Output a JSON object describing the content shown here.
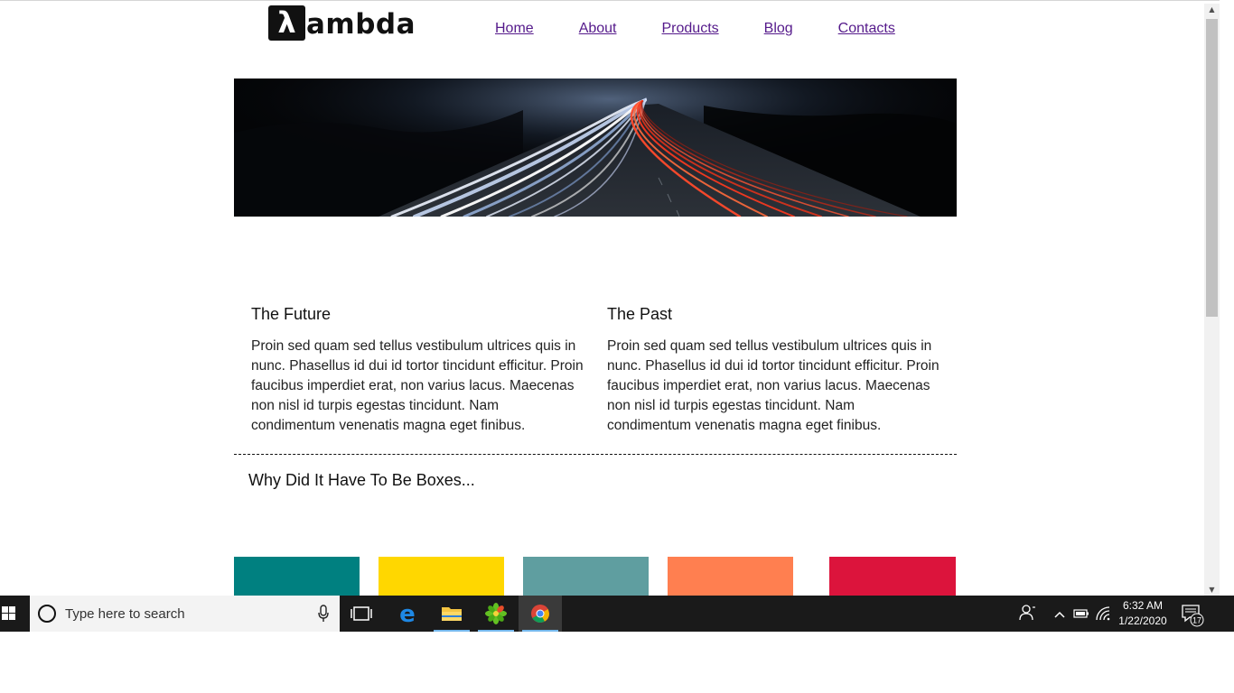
{
  "site": {
    "logo_text": "ambda",
    "logo_symbol": "λ",
    "nav": [
      "Home",
      "About",
      "Products",
      "Blog",
      "Contacts"
    ]
  },
  "hero": {
    "image": "highway-light-trails-at-night"
  },
  "columns": [
    {
      "title": "The Future",
      "body": "Proin sed quam sed tellus vestibulum ultrices quis in nunc. Phasellus id dui id tortor tincidunt efficitur. Proin faucibus imperdiet erat, non varius lacus. Maecenas non nisl id turpis egestas tincidunt. Nam condimentum venenatis magna eget finibus."
    },
    {
      "title": "The Past",
      "body": "Proin sed quam sed tellus vestibulum ultrices quis in nunc. Phasellus id dui id tortor tincidunt efficitur. Proin faucibus imperdiet erat, non varius lacus. Maecenas non nisl id turpis egestas tincidunt. Nam condimentum venenatis magna eget finibus."
    }
  ],
  "boxes_heading": "Why Did It Have To Be Boxes...",
  "box_colors": [
    "#008080",
    "#ffd700",
    "#5f9ea0",
    "#ff7f50",
    "#dc143c"
  ],
  "taskbar": {
    "search_placeholder": "Type here to search",
    "icons": [
      "windows-start-icon",
      "cortana-search-icon",
      "microphone-icon",
      "task-view-icon",
      "edge-icon",
      "file-explorer-icon",
      "icq-icon",
      "chrome-icon"
    ],
    "clock_time": "6:32 AM",
    "clock_date": "1/22/2020",
    "notification_count": "17"
  }
}
